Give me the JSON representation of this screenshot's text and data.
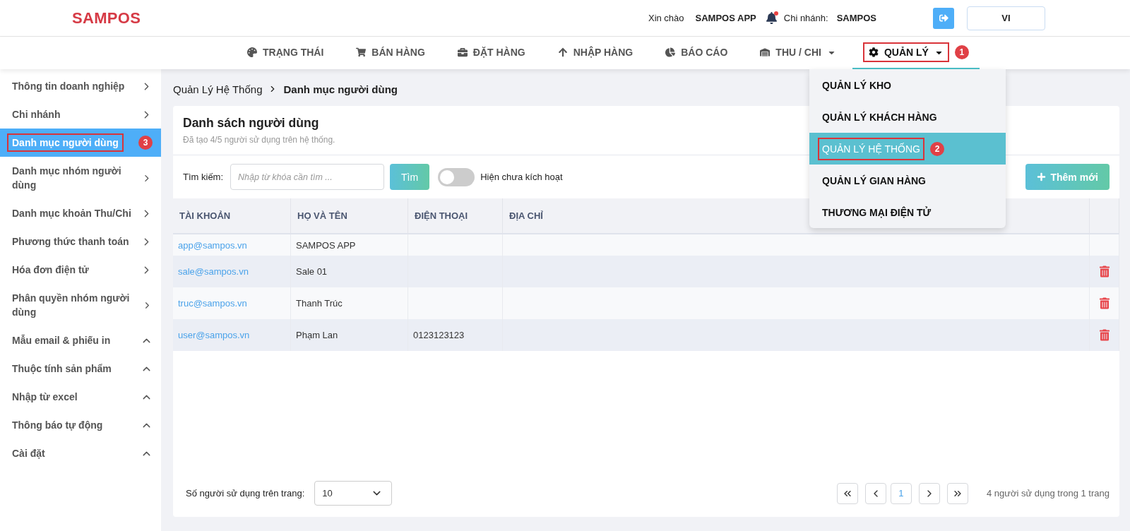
{
  "header": {
    "logo": "SAMPOS",
    "greeting": "Xin chào",
    "user": "SAMPOS APP",
    "notification": true,
    "branch_label": "Chi nhánh:",
    "branch": "SAMPOS",
    "language": "VI"
  },
  "nav": [
    {
      "label": "TRẠNG THÁI",
      "selected": false,
      "has_menu": false
    },
    {
      "label": "BÁN HÀNG",
      "selected": false,
      "has_menu": false
    },
    {
      "label": "ĐẶT HÀNG",
      "selected": false,
      "has_menu": false
    },
    {
      "label": "NHẬP HÀNG",
      "selected": false,
      "has_menu": false
    },
    {
      "label": "BÁO CÁO",
      "selected": false,
      "has_menu": false
    },
    {
      "label": "THU / CHI",
      "selected": false,
      "has_menu": true
    },
    {
      "label": "QUẢN LÝ",
      "selected": true,
      "has_menu": true,
      "callout": "1"
    }
  ],
  "nav_menu": [
    {
      "label": "QUẢN LÝ KHO",
      "selected": false
    },
    {
      "label": "QUẢN LÝ KHÁCH HÀNG",
      "selected": false
    },
    {
      "label": "QUẢN LÝ HỆ THỐNG",
      "selected": true,
      "callout": "2"
    },
    {
      "label": "QUẢN LÝ GIAN HÀNG",
      "selected": false
    },
    {
      "label": "THƯƠNG MẠI ĐIỆN TỬ",
      "selected": false
    }
  ],
  "sidebar": {
    "items": [
      {
        "label": "Thông tin doanh nghiệp",
        "kind": "page",
        "selected": false
      },
      {
        "label": "Chi nhánh",
        "kind": "page",
        "selected": false
      },
      {
        "label": "Danh mục người dùng",
        "kind": "page",
        "selected": true,
        "callout": "3"
      },
      {
        "label": "Danh mục nhóm người dùng",
        "kind": "page",
        "selected": false
      },
      {
        "label": "Danh mục khoản Thu/Chi",
        "kind": "page",
        "selected": false
      },
      {
        "label": "Phương thức thanh toán",
        "kind": "page",
        "selected": false
      },
      {
        "label": "Hóa đơn điện tử",
        "kind": "page",
        "selected": false
      },
      {
        "label": "Phân quyền nhóm người dùng",
        "kind": "page",
        "selected": false
      },
      {
        "label": "Mẫu email & phiếu in",
        "kind": "group",
        "selected": false
      },
      {
        "label": "Thuộc tính sản phẩm",
        "kind": "group",
        "selected": false
      },
      {
        "label": "Nhập từ excel",
        "kind": "group",
        "selected": false
      },
      {
        "label": "Thông báo tự động",
        "kind": "group",
        "selected": false
      },
      {
        "label": "Cài đặt",
        "kind": "group",
        "selected": false
      }
    ]
  },
  "breadcrumb": [
    "Quản Lý Hệ Thống",
    "Danh mục người dùng"
  ],
  "card": {
    "title": "Danh sách người dùng",
    "subtitle": "Đã tạo 4/5 người sử dụng trên hệ thống.",
    "search_label": "Tìm kiếm:",
    "search_placeholder": "Nhập từ khóa cần tìm ...",
    "search_button": "Tìm",
    "toggle": {
      "label": "Hiện chưa kích hoạt",
      "on": false
    },
    "add_button": "Thêm mới"
  },
  "table": {
    "columns": [
      "TÀI KHOẢN",
      "HỌ VÀ TÊN",
      "ĐIỆN THOẠI",
      "ĐỊA CHỈ"
    ],
    "rows": [
      {
        "account": "app@sampos.vn",
        "name": "SAMPOS APP",
        "phone": "",
        "address": "",
        "deletable": false
      },
      {
        "account": "sale@sampos.vn",
        "name": "Sale 01",
        "phone": "",
        "address": "",
        "deletable": true
      },
      {
        "account": "truc@sampos.vn",
        "name": "Thanh Trúc",
        "phone": "",
        "address": "",
        "deletable": true
      },
      {
        "account": "user@sampos.vn",
        "name": "Phạm Lan",
        "phone": "0123123123",
        "address": "",
        "deletable": true
      }
    ]
  },
  "footer": {
    "page_size_label": "Số người sử dụng trên trang:",
    "page_size": "10",
    "pages": [
      {
        "label": "1",
        "selected": true
      }
    ],
    "summary": "4 người sử dụng trong 1 trang"
  }
}
